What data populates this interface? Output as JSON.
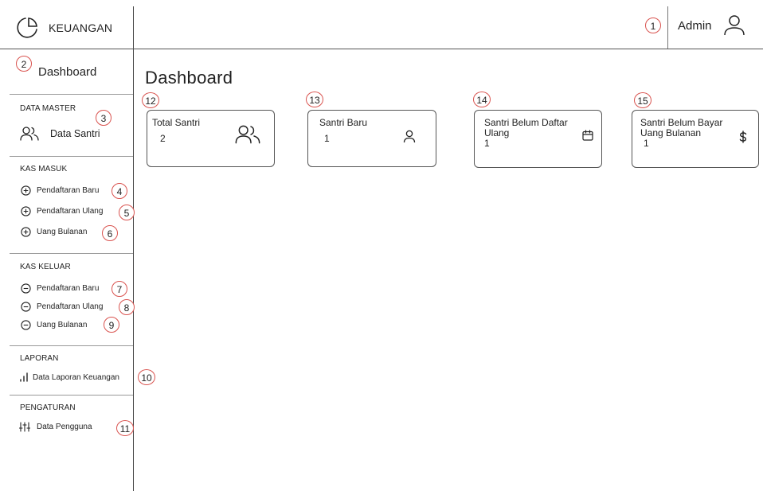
{
  "app": {
    "brand": "KEUANGAN",
    "brand_icon": "pie-chart-icon"
  },
  "header": {
    "user_label": "Admin",
    "user_icon": "user-icon"
  },
  "markers": [
    "1",
    "2",
    "3",
    "4",
    "5",
    "6",
    "7",
    "8",
    "9",
    "10",
    "11",
    "12",
    "13",
    "14",
    "15"
  ],
  "sidebar": {
    "dashboard_label": "Dashboard",
    "sections": [
      {
        "title": "DATA MASTER",
        "items": [
          {
            "label": "Data Santri",
            "icon": "users-icon"
          }
        ]
      },
      {
        "title": "KAS MASUK",
        "items": [
          {
            "label": "Pendaftaran Baru",
            "icon": "plus-circle-icon"
          },
          {
            "label": "Pendaftaran Ulang",
            "icon": "plus-circle-icon"
          },
          {
            "label": "Uang Bulanan",
            "icon": "plus-circle-icon"
          }
        ]
      },
      {
        "title": "KAS KELUAR",
        "items": [
          {
            "label": "Pendaftaran Baru",
            "icon": "minus-circle-icon"
          },
          {
            "label": "Pendaftaran Ulang",
            "icon": "minus-circle-icon"
          },
          {
            "label": "Uang Bulanan",
            "icon": "minus-circle-icon"
          }
        ]
      },
      {
        "title": "LAPORAN",
        "items": [
          {
            "label": "Data Laporan Keuangan",
            "icon": "bar-chart-icon"
          }
        ]
      },
      {
        "title": "PENGATURAN",
        "items": [
          {
            "label": "Data Pengguna",
            "icon": "sliders-icon"
          }
        ]
      }
    ]
  },
  "main": {
    "title": "Dashboard",
    "cards": [
      {
        "label": "Total Santri",
        "value": "2",
        "icon": "users-icon"
      },
      {
        "label": "Santri Baru",
        "value": "1",
        "icon": "user-icon"
      },
      {
        "label_line1": "Santri Belum Daftar",
        "label_line2": "Ulang",
        "value": "1",
        "icon": "calendar-icon"
      },
      {
        "label_line1": "Santri Belum Bayar",
        "label_line2": "Uang Bulanan",
        "value": "1",
        "icon": "dollar-icon"
      }
    ]
  },
  "colors": {
    "marker_border": "#d9534f",
    "line": "#444444"
  }
}
